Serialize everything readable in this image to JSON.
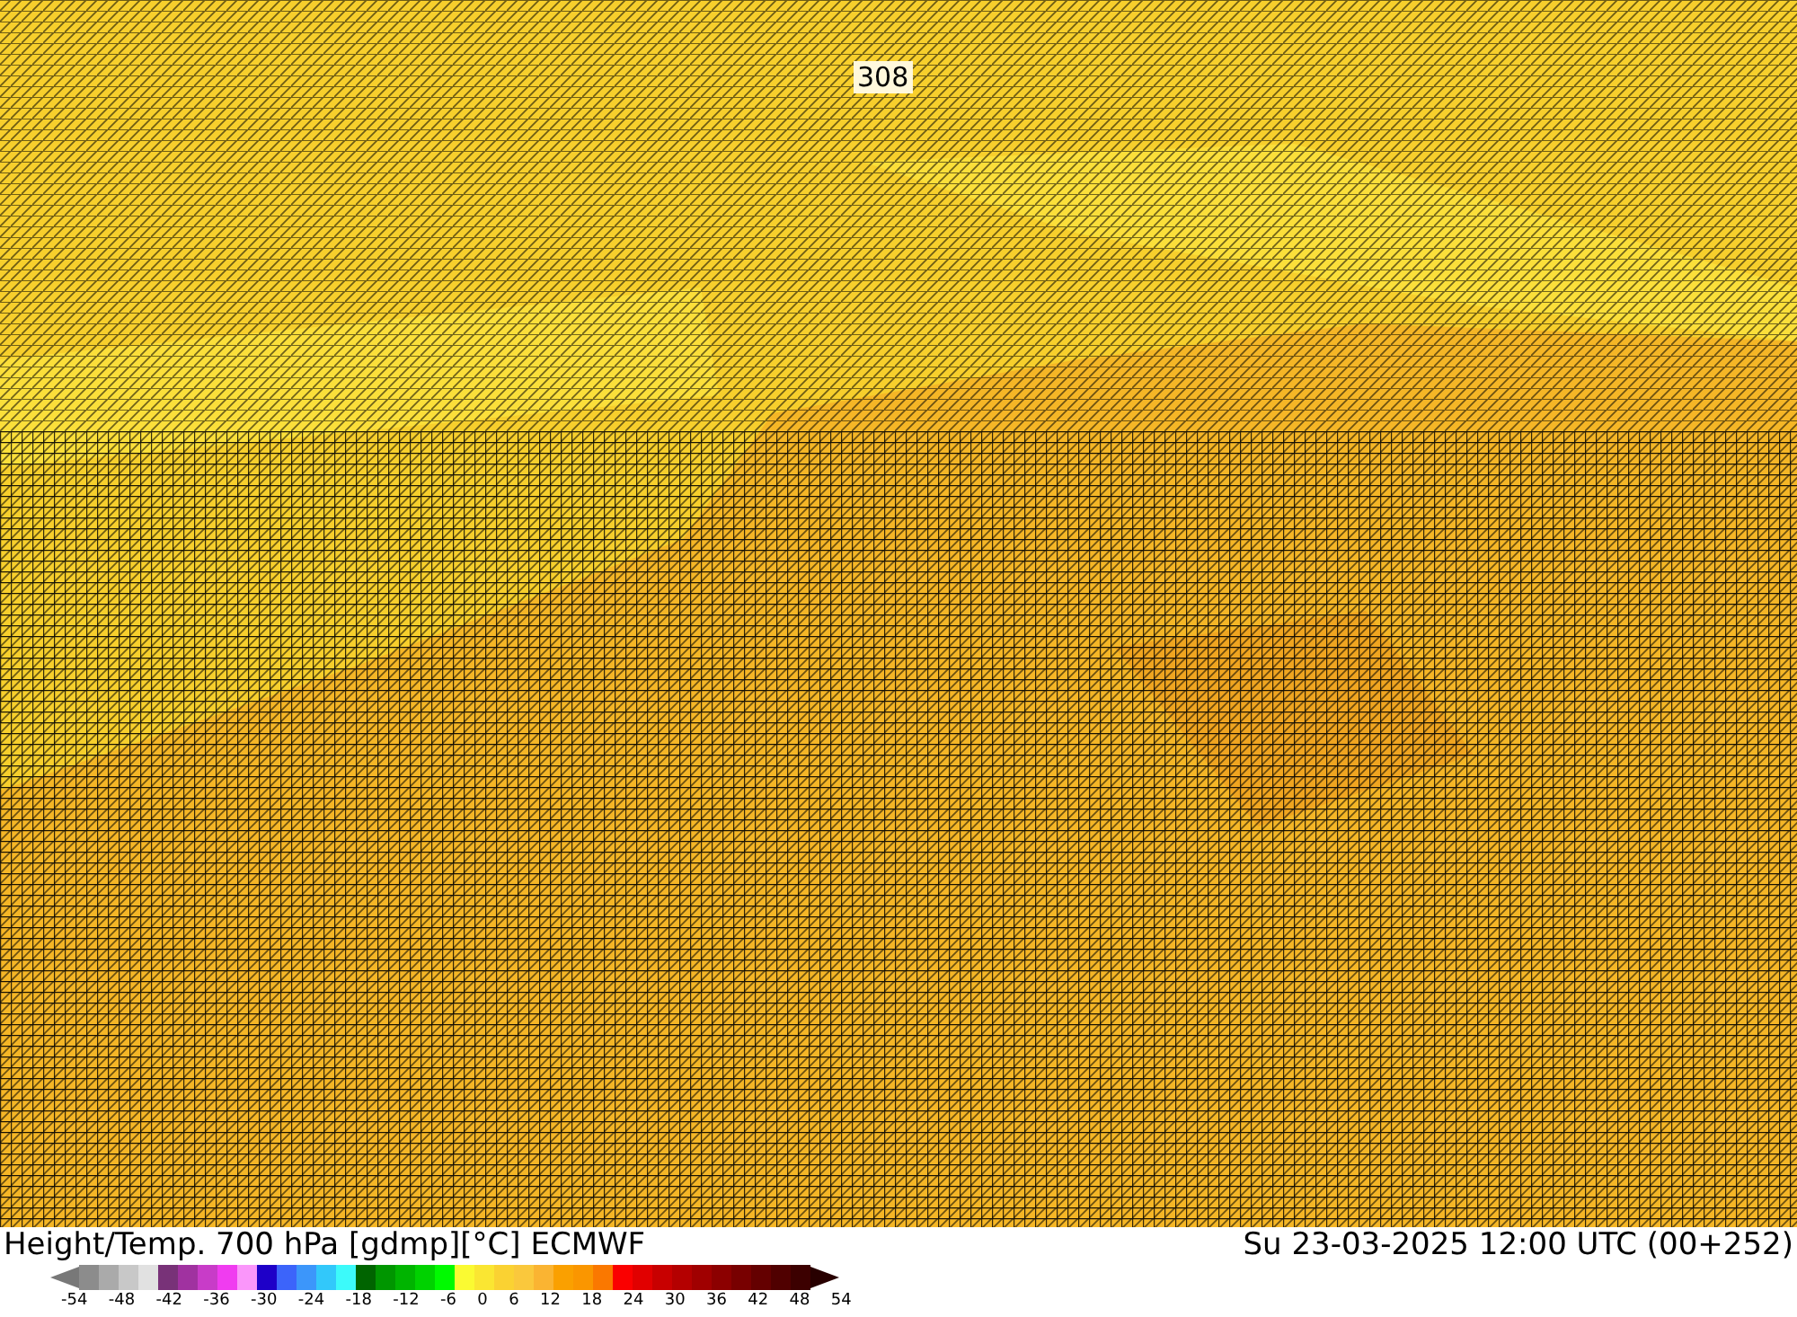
{
  "map": {
    "contour_label": "308"
  },
  "footer": {
    "title": "Height/Temp. 700 hPa [gdmp][°C] ECMWF",
    "valid_time": "Su 23-03-2025 12:00 UTC (00+252)"
  },
  "colorbar": {
    "low_arrow": {
      "color": "#787878"
    },
    "high_arrow": {
      "color": "#280000"
    },
    "swatches": [
      {
        "color": "#8c8c8c"
      },
      {
        "color": "#aaaaaa"
      },
      {
        "color": "#c8c8c8"
      },
      {
        "color": "#e1e1e1"
      },
      {
        "color": "#783278"
      },
      {
        "color": "#a032a0"
      },
      {
        "color": "#c83cc8"
      },
      {
        "color": "#f03cf0"
      },
      {
        "color": "#fa96fa"
      },
      {
        "color": "#1e00c8"
      },
      {
        "color": "#3c64fa"
      },
      {
        "color": "#3c96fa"
      },
      {
        "color": "#32c8fa"
      },
      {
        "color": "#3cfafa"
      },
      {
        "color": "#006400"
      },
      {
        "color": "#009600"
      },
      {
        "color": "#00b400"
      },
      {
        "color": "#00d200"
      },
      {
        "color": "#00fa00"
      },
      {
        "color": "#fafa32"
      },
      {
        "color": "#fae632"
      },
      {
        "color": "#fad232"
      },
      {
        "color": "#fac83c"
      },
      {
        "color": "#fab432"
      },
      {
        "color": "#faa000"
      },
      {
        "color": "#fa9600"
      },
      {
        "color": "#fa7800"
      },
      {
        "color": "#fa0000"
      },
      {
        "color": "#e10000"
      },
      {
        "color": "#c80000"
      },
      {
        "color": "#b40000"
      },
      {
        "color": "#a00000"
      },
      {
        "color": "#8c0000"
      },
      {
        "color": "#780000"
      },
      {
        "color": "#640000"
      },
      {
        "color": "#500000"
      },
      {
        "color": "#3c0000"
      }
    ],
    "ticks": [
      "-54",
      "-48",
      "-42",
      "-36",
      "-30",
      "-24",
      "-18",
      "-12",
      "-6",
      "0",
      "6",
      "12",
      "18",
      "24",
      "30",
      "36",
      "42",
      "48",
      "54"
    ]
  }
}
